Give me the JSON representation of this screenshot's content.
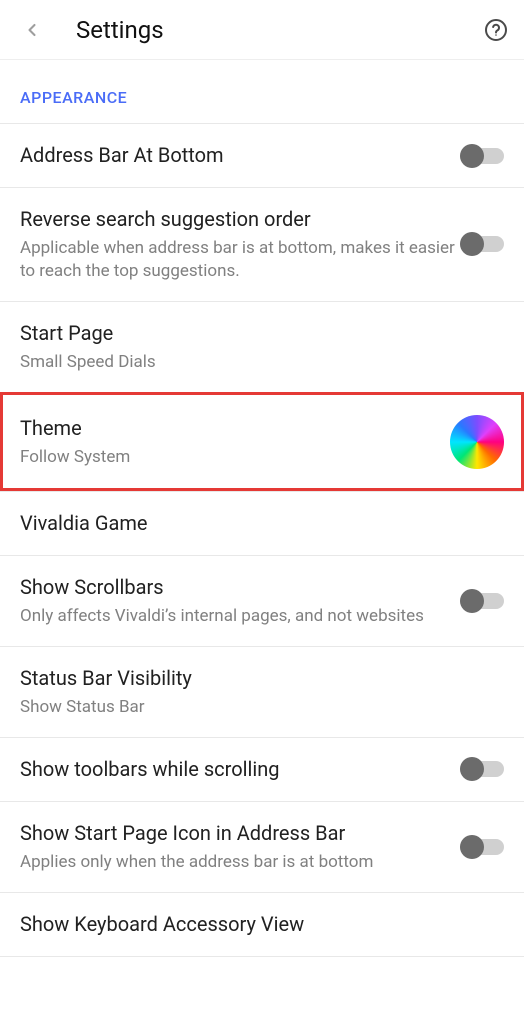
{
  "header": {
    "title": "Settings"
  },
  "section": {
    "label": "APPEARANCE"
  },
  "rows": {
    "addressBar": {
      "title": "Address Bar At Bottom"
    },
    "reverseSearch": {
      "title": "Reverse search suggestion order",
      "sub": "Applicable when address bar is at bottom, makes it easier to reach the top suggestions."
    },
    "startPage": {
      "title": "Start Page",
      "sub": "Small Speed Dials"
    },
    "theme": {
      "title": "Theme",
      "sub": "Follow System"
    },
    "vivaldia": {
      "title": "Vivaldia Game"
    },
    "scrollbars": {
      "title": "Show Scrollbars",
      "sub": "Only affects Vivaldi’s internal pages, and not websites"
    },
    "statusBar": {
      "title": "Status Bar Visibility",
      "sub": "Show Status Bar"
    },
    "toolbars": {
      "title": "Show toolbars while scrolling"
    },
    "startIcon": {
      "title": "Show Start Page Icon in Address Bar",
      "sub": "Applies only when the address bar is at bottom"
    },
    "keyboard": {
      "title": "Show Keyboard Accessory View"
    }
  }
}
